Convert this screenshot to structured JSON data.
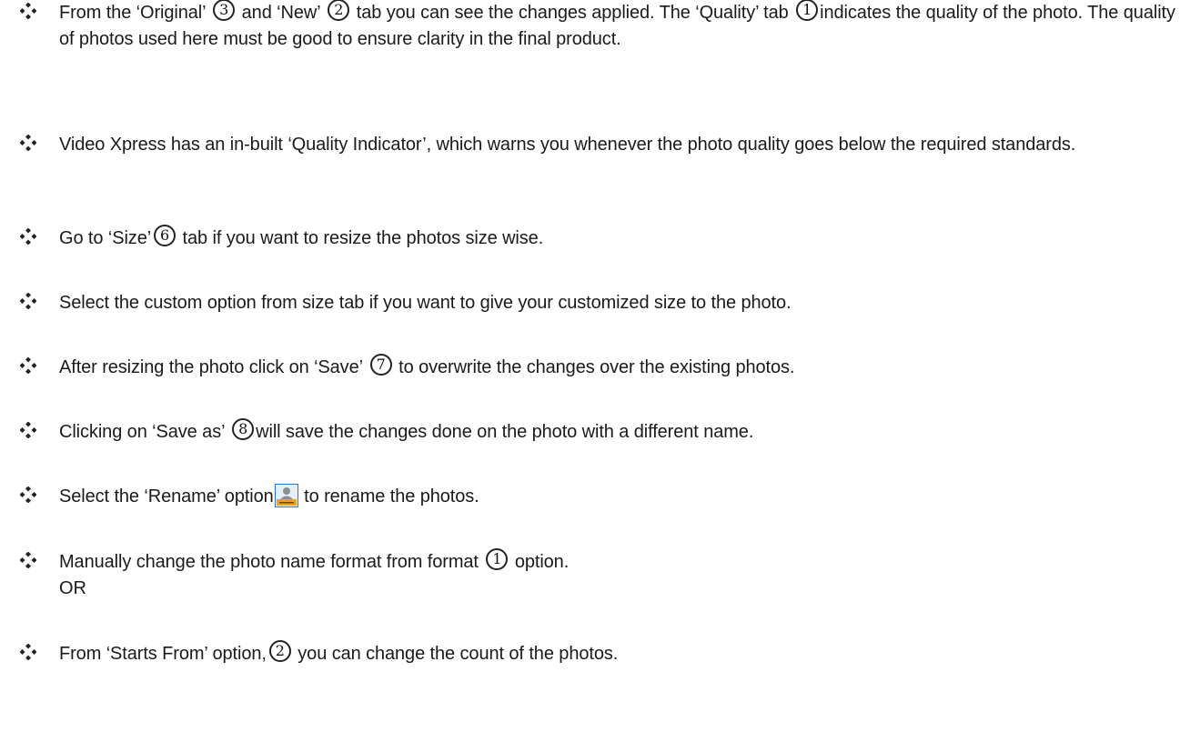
{
  "bullets": [
    {
      "id": "tabs",
      "parts": [
        {
          "t": "text",
          "v": "From the ‘Original’ "
        },
        {
          "t": "num",
          "v": "3"
        },
        {
          "t": "text",
          "v": " and ‘New’ "
        },
        {
          "t": "num",
          "v": "2"
        },
        {
          "t": "text",
          "v": " tab you can see the changes applied. The ‘Quality’ tab "
        },
        {
          "t": "num",
          "v": "1"
        },
        {
          "t": "text",
          "v": "indicates the quality of the photo. The quality of photos used here must be good to ensure clarity in the final product."
        }
      ]
    },
    {
      "id": "quality-indicator",
      "parts": [
        {
          "t": "text",
          "v": "Video Xpress has an in-built ‘Quality Indicator’, which warns you whenever the photo quality goes below the required standards."
        }
      ]
    },
    {
      "id": "size-tab",
      "parts": [
        {
          "t": "text",
          "v": "Go to ‘Size’"
        },
        {
          "t": "num",
          "v": "6"
        },
        {
          "t": "text",
          "v": " tab if you want to resize the photos size wise."
        }
      ]
    },
    {
      "id": "custom-size",
      "parts": [
        {
          "t": "text",
          "v": "Select the custom option from size tab if you want to give your customized size to the photo."
        }
      ]
    },
    {
      "id": "save",
      "parts": [
        {
          "t": "text",
          "v": "After resizing the photo click on ‘Save’ "
        },
        {
          "t": "num",
          "v": "7"
        },
        {
          "t": "text",
          "v": " to overwrite the changes over the existing photos."
        }
      ]
    },
    {
      "id": "save-as",
      "parts": [
        {
          "t": "text",
          "v": "Clicking on ‘Save as’ "
        },
        {
          "t": "num",
          "v": "8"
        },
        {
          "t": "text",
          "v": "will save the changes done on the photo with a different name."
        }
      ]
    },
    {
      "id": "rename",
      "parts": [
        {
          "t": "text",
          "v": "Select the ‘Rename’ option"
        },
        {
          "t": "icon",
          "v": "rename-icon"
        },
        {
          "t": "text",
          "v": " to rename the photos."
        }
      ]
    },
    {
      "id": "format",
      "parts": [
        {
          "t": "text",
          "v": "Manually change the photo name format from format "
        },
        {
          "t": "num",
          "v": "1"
        },
        {
          "t": "text",
          "v": " option."
        },
        {
          "t": "br"
        },
        {
          "t": "text",
          "v": "OR"
        }
      ]
    },
    {
      "id": "starts-from",
      "parts": [
        {
          "t": "text",
          "v": "From ‘Starts From’ option,"
        },
        {
          "t": "num",
          "v": "2"
        },
        {
          "t": "text",
          "v": " you can change the count of the photos."
        }
      ]
    }
  ],
  "bullet_icon": "diamond-bullet-icon",
  "colors": {
    "text": "#1a1a1a",
    "bullet": "#222222",
    "rename_icon_accent": "#f5a300",
    "rename_icon_frame": "#2b78c8"
  }
}
